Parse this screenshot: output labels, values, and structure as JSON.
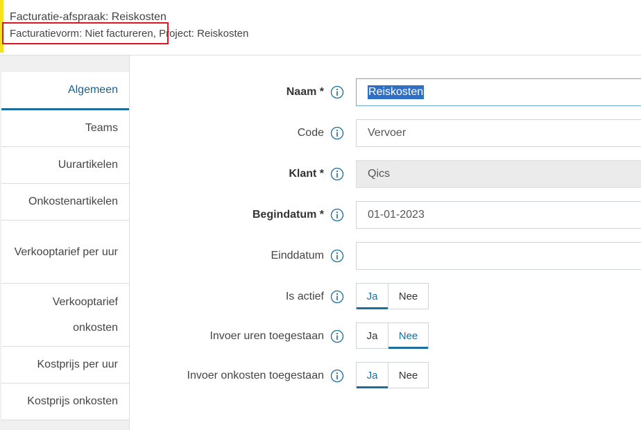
{
  "header": {
    "title": "Facturatie-afspraak: Reiskosten",
    "subtitle": "Facturatievorm: Niet factureren, Project: Reiskosten"
  },
  "sidebar": {
    "items": [
      {
        "label": "Algemeen",
        "active": true
      },
      {
        "label": "Teams"
      },
      {
        "label": "Uurartikelen"
      },
      {
        "label": "Onkostenartikelen"
      },
      {
        "label": "Verkooptarief per uur"
      },
      {
        "label": "Verkooptarief onkosten"
      },
      {
        "label": "Kostprijs per uur"
      },
      {
        "label": "Kostprijs onkosten"
      }
    ]
  },
  "form": {
    "naam": {
      "label": "Naam *",
      "value": "Reiskosten"
    },
    "code": {
      "label": "Code",
      "value": "Vervoer"
    },
    "klant": {
      "label": "Klant *",
      "value": "Qics"
    },
    "begindatum": {
      "label": "Begindatum *",
      "value": "01-01-2023"
    },
    "einddatum": {
      "label": "Einddatum",
      "value": ""
    },
    "is_actief": {
      "label": "Is actief",
      "yes": "Ja",
      "no": "Nee",
      "selected": "Ja"
    },
    "invoer_uren": {
      "label": "Invoer uren toegestaan",
      "yes": "Ja",
      "no": "Nee",
      "selected": "Nee"
    },
    "invoer_onkosten": {
      "label": "Invoer onkosten toegestaan",
      "yes": "Ja",
      "no": "Nee",
      "selected": "Ja"
    }
  },
  "colors": {
    "accent": "#1a6e9c",
    "header_accent": "#f4e21a",
    "highlight": "#e0141e"
  }
}
